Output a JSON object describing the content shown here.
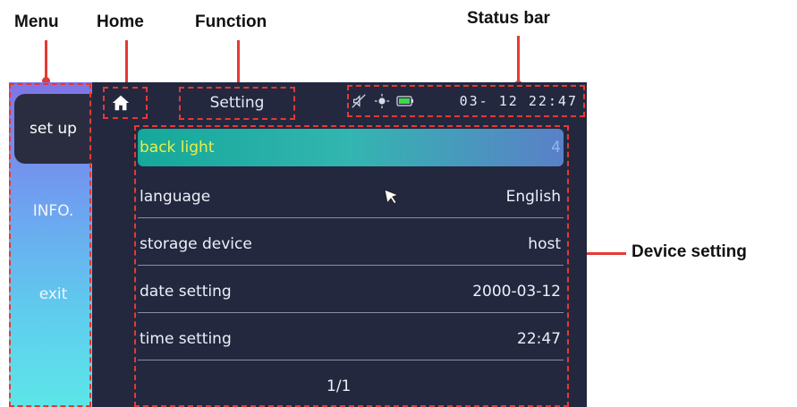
{
  "annotations": {
    "menu": "Menu",
    "home": "Home",
    "function": "Function",
    "status_bar": "Status bar",
    "device_setting": "Device setting"
  },
  "menu": {
    "items": [
      {
        "label": "set up"
      },
      {
        "label": "INFO."
      },
      {
        "label": "exit"
      }
    ]
  },
  "function_title": "Setting",
  "status_bar": {
    "icons": [
      "mute-icon",
      "brightness-icon",
      "battery-icon"
    ],
    "clock": "03- 12 22:47"
  },
  "settings": {
    "rows": [
      {
        "label": "back light",
        "value": "4"
      },
      {
        "label": "language",
        "value": "English"
      },
      {
        "label": "storage device",
        "value": "host"
      },
      {
        "label": "date setting",
        "value": "2000-03-12"
      },
      {
        "label": "time setting",
        "value": "22:47"
      }
    ]
  },
  "pager": "1/1",
  "colors": {
    "annotation": "#e53935",
    "screen_bg": "#23283f",
    "selected_label": "#e5f04a",
    "accent": "#1aa99b"
  }
}
